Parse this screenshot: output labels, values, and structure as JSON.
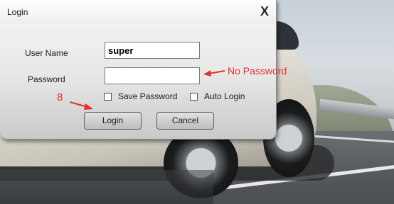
{
  "dialog": {
    "title": "Login",
    "close_glyph": "X",
    "username_label": "User Name",
    "username_value": "super",
    "password_label": "Password",
    "password_value": "",
    "save_password_label": "Save Password",
    "save_password_checked": false,
    "auto_login_label": "Auto Login",
    "auto_login_checked": false,
    "login_button": "Login",
    "cancel_button": "Cancel"
  },
  "annotations": {
    "no_password": "No Password",
    "step_number": "8",
    "color": "#e0302c"
  },
  "icons": {
    "close": "close-icon",
    "arrows": [
      "arrow-to-password-icon",
      "arrow-to-login-icon"
    ]
  }
}
